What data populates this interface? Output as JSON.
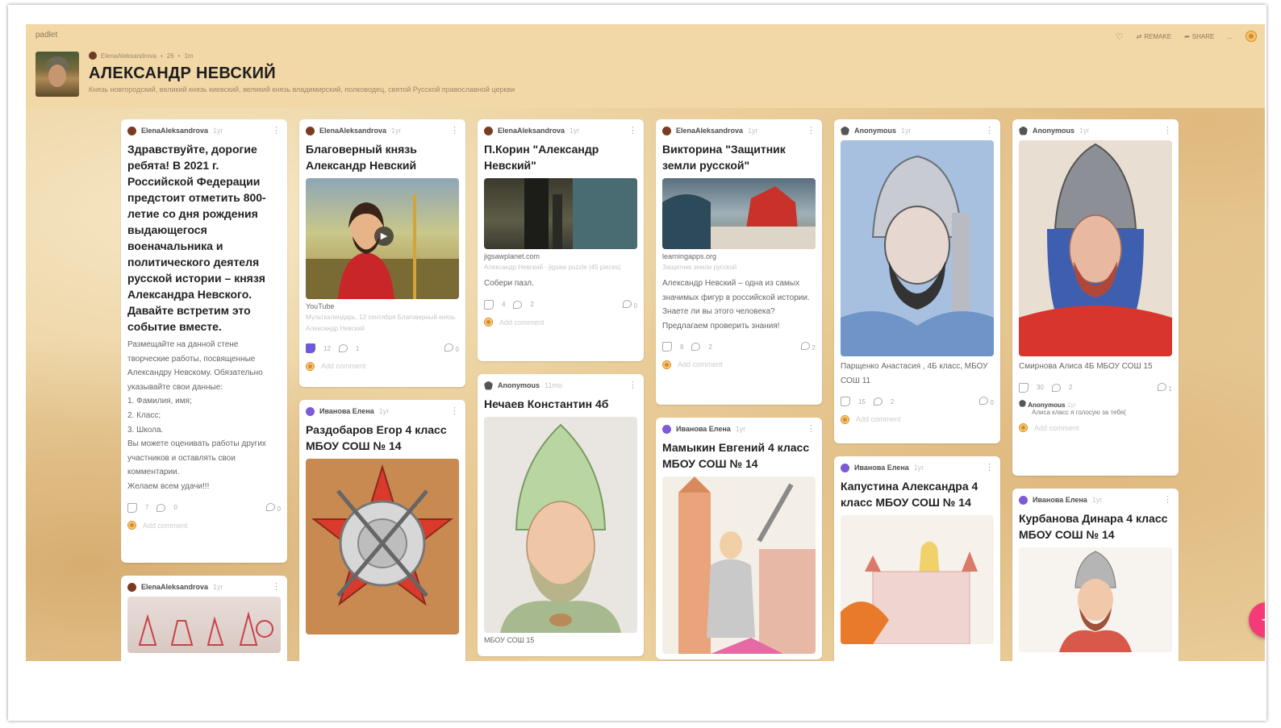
{
  "app": {
    "logo": "padlet"
  },
  "toolbar": {
    "remake": "REMAKE",
    "share": "SHARE",
    "more": "...",
    "heart_icon": "heart-icon"
  },
  "board": {
    "author": "ElenaAleksandrova",
    "meta_likes": "26",
    "meta_age": "1m",
    "title": "АЛЕКСАНДР НЕВСКИЙ",
    "subtitle": "Князь новгородский, великий князь киевский, великий князь владимирский, полководец, святой Русской православной церкви"
  },
  "posts": [
    {
      "author": "ElenaAleksandrova",
      "age": "1yr",
      "title": "Здравствуйте, дорогие ребята! В 2021 г. Российской Федерации предстоит отметить 800-летие со дня рождения выдающегося военачальника и политического деятеля русской истории – князя Александра Невского. Давайте встретим это событие вместе.",
      "body": "Размещайте на данной стене творческие работы, посвященные Александру Невскому. Обязательно указывайте свои данные:\n1. Фамилия, имя;\n2. Класс;\n3. Школа.\nВы можете оценивать работы других участников и оставлять свои комментарии.\nЖелаем всем удачи!!!",
      "likes": "7",
      "dislikes": "0",
      "comments": "0",
      "add_comment": "Add comment"
    },
    {
      "author": "ElenaAleksandrova",
      "age": "1yr"
    },
    {
      "author": "ElenaAleksandrova",
      "age": "1yr",
      "title": "Благоверный князь Александр Невский",
      "source": "YouTube",
      "source_desc": "Мульткалендарь. 12 сентября Благоверный князь Александр Невский",
      "likes": "12",
      "dislikes": "1",
      "comments": "0",
      "add_comment": "Add comment"
    },
    {
      "author": "Иванова Елена",
      "age": "1yr",
      "title": "Раздобаров Егор 4 класс МБОУ СОШ № 14"
    },
    {
      "author": "ElenaAleksandrova",
      "age": "1yr",
      "title": "П.Корин \"Александр Невский\"",
      "source": "jigsawplanet.com",
      "source_desc": "Александр Невский - jigsaw puzzle (45 pieces)",
      "body": "Собери пазл.",
      "likes": "4",
      "dislikes": "2",
      "comments": "0",
      "add_comment": "Add comment"
    },
    {
      "author": "Anonymous",
      "age": "11mo",
      "title": "Нечаев Константин 4б",
      "caption": "МБОУ СОШ 15"
    },
    {
      "author": "ElenaAleksandrova",
      "age": "1yr",
      "title": "Викторина \"Защитник земли русской\"",
      "source": "learningapps.org",
      "source_desc": "Защитник земли русской",
      "body": "Александр Невский – одна из самых значимых фигур в российской истории.\nЗнаете ли вы этого человека?\nПредлагаем проверить знания!",
      "likes": "8",
      "dislikes": "2",
      "comments": "2",
      "add_comment": "Add comment"
    },
    {
      "author": "Иванова Елена",
      "age": "1yr",
      "title": "Мамыкин Евгений 4 класс МБОУ СОШ № 14"
    },
    {
      "author": "Anonymous",
      "age": "1yr",
      "body": "Парщенко Анастасия , 4Б класс, МБОУ СОШ 11",
      "likes": "15",
      "dislikes": "2",
      "comments": "0",
      "add_comment": "Add comment"
    },
    {
      "author": "Иванова Елена",
      "age": "1yr",
      "title": "Капустина Александра 4 класс МБОУ СОШ № 14"
    },
    {
      "author": "Anonymous",
      "age": "1yr",
      "body": "Смирнова Алиса 4Б МБОУ СОШ 15",
      "likes": "30",
      "dislikes": "2",
      "comments": "1",
      "comment_author": "Anonymous",
      "comment_age": "1yr",
      "comment_text": "Алиса класс я голосую за тебя(",
      "add_comment": "Add comment"
    },
    {
      "author": "Иванова Елена",
      "age": "1yr",
      "title": "Курбанова Динара 4 класс МБОУ СОШ № 14"
    }
  ],
  "fab": {
    "label": "+"
  }
}
